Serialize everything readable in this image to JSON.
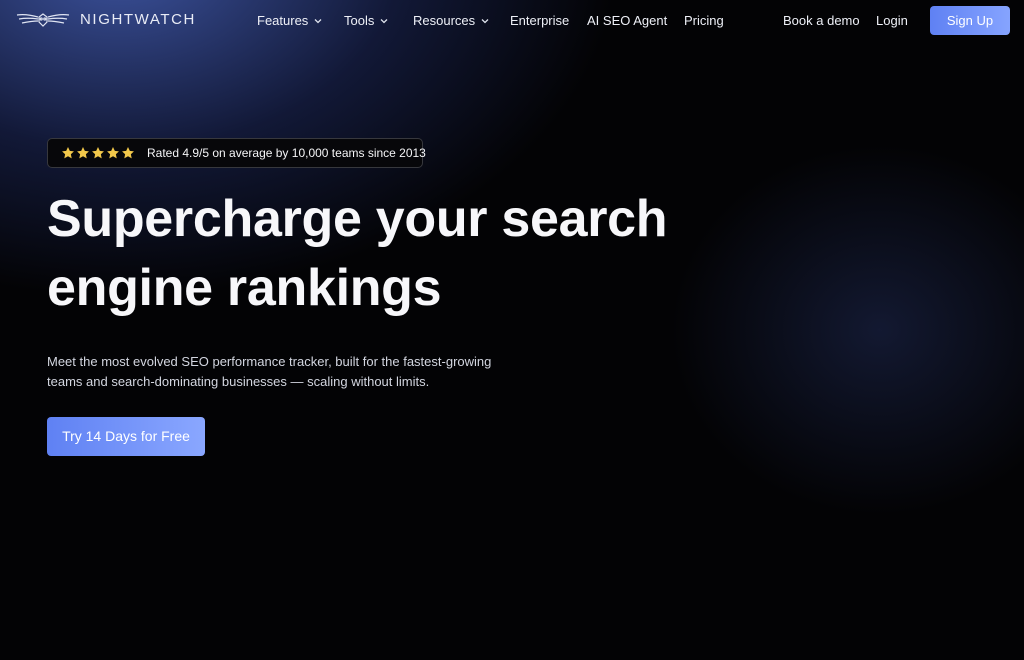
{
  "brand": {
    "name": "NIGHTWATCH",
    "logo_icon": "owl-wings-icon"
  },
  "nav": {
    "items": [
      {
        "label": "Features",
        "has_dropdown": true
      },
      {
        "label": "Tools",
        "has_dropdown": true
      },
      {
        "label": "Resources",
        "has_dropdown": true
      },
      {
        "label": "Enterprise",
        "has_dropdown": false
      },
      {
        "label": "AI SEO Agent",
        "has_dropdown": false
      },
      {
        "label": "Pricing",
        "has_dropdown": false
      }
    ],
    "book_demo": "Book a demo",
    "login": "Login",
    "signup": "Sign Up"
  },
  "hero": {
    "rating": {
      "stars": 5,
      "text": "Rated 4.9/5 on average by 10,000 teams since 2013"
    },
    "headline_line1": "Supercharge your search",
    "headline_line2": "engine rankings",
    "subheadline_line1": "Meet the most evolved SEO performance tracker, built for the fastest-growing",
    "subheadline_line2": "teams and search-dominating businesses — scaling without limits.",
    "cta": "Try 14 Days for Free"
  },
  "colors": {
    "accent": "#6d8ef7",
    "star": "#f2c84b",
    "background": "#030305"
  }
}
